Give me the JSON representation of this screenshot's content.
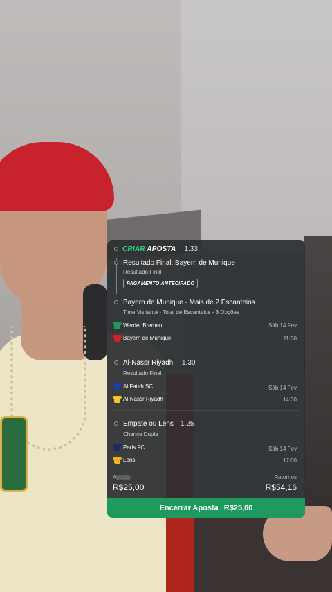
{
  "slip": {
    "brand_a": "CRIAR",
    "brand_b": "APOSTA",
    "total_odds": "1.33",
    "legs": [
      {
        "title": "Resultado Final: Bayern de Munique",
        "market": "Resultado Final",
        "badge": "PAGAMENTO ANTECIPADO"
      },
      {
        "title": "Bayern de Munique - Mais de 2 Escanteios",
        "market": "Time Visitante - Total de Escanteios - 3 Opções"
      }
    ],
    "match1": {
      "home": "Werder Bremen",
      "away": "Bayern de Munique",
      "date": "Sáb 14 Fev",
      "time": "11:30"
    },
    "bet2": {
      "selection": "Al-Nassr Riyadh",
      "odds": "1.30",
      "market": "Resultado Final",
      "home": "Al Fateh SC",
      "away": "Al-Nassr Riyadh",
      "date": "Sáb 14 Fev",
      "time": "14:30"
    },
    "bet3": {
      "selection": "Empate ou Lens",
      "odds": "1.25",
      "market": "Chance Dupla",
      "home": "Paris FC",
      "away": "Lens",
      "date": "Sáb 14 Fev",
      "time": "17:00"
    },
    "stake_label": "Aposta",
    "stake_value": "R$25,00",
    "returns_label": "Retornos",
    "returns_value": "R$54,16",
    "cashout_label": "Encerrar Aposta",
    "cashout_value": "R$25,00"
  },
  "colors": {
    "accent_green": "#2fd58b",
    "cashout_green": "#1f9a5e",
    "card_bg": "#2c2f32",
    "werder_kit": "#1d9a55",
    "bayern_kit": "#d1202d",
    "fateh_kit": "#1d3fa8",
    "nassr_kit": "#f3c623",
    "paris_kit": "#1b2a66",
    "lens_kit": "#f2b01e"
  },
  "icons": [
    "shirt-icon"
  ]
}
